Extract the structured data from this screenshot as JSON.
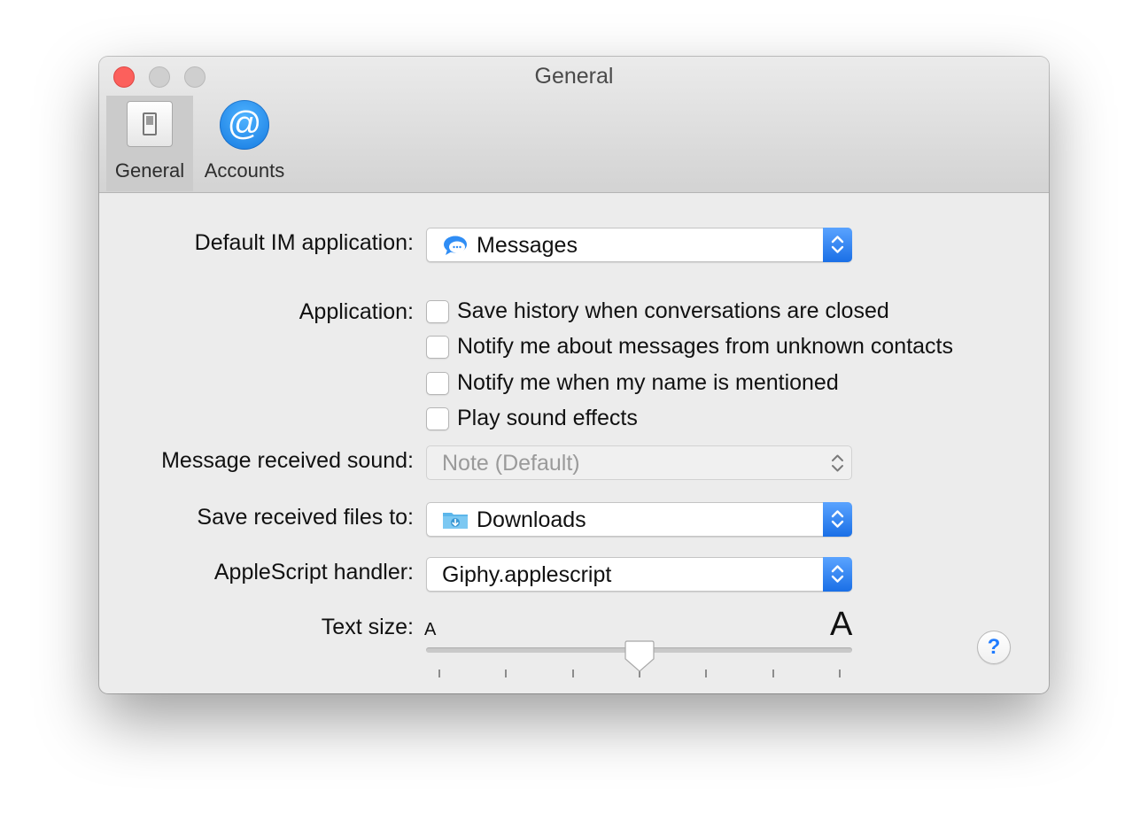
{
  "window": {
    "title": "General"
  },
  "toolbar": {
    "items": [
      {
        "label": "General",
        "icon": "switch-icon",
        "selected": true
      },
      {
        "label": "Accounts",
        "icon": "at-sign-icon",
        "glyph": "@",
        "selected": false
      }
    ]
  },
  "prefs": {
    "default_im": {
      "label": "Default IM application:",
      "value": "Messages",
      "icon": "messages-icon"
    },
    "application": {
      "label": "Application:",
      "options": [
        {
          "label": "Save history when conversations are closed",
          "checked": false
        },
        {
          "label": "Notify me about messages from unknown contacts",
          "checked": false
        },
        {
          "label": "Notify me when my name is mentioned",
          "checked": false
        },
        {
          "label": "Play sound effects",
          "checked": false
        }
      ]
    },
    "sound": {
      "label": "Message received sound:",
      "value": "Note (Default)",
      "enabled": false
    },
    "save_files": {
      "label": "Save received files to:",
      "value": "Downloads",
      "icon": "downloads-folder-icon"
    },
    "applescript": {
      "label": "AppleScript handler:",
      "value": "Giphy.applescript"
    },
    "text_size": {
      "label": "Text size:",
      "small_glyph": "A",
      "large_glyph": "A",
      "ticks": 7,
      "selected_step": 4
    }
  },
  "help": {
    "glyph": "?"
  },
  "colors": {
    "accent": "#1a6fe6",
    "close": "#fc605c",
    "window_bg": "#ececec"
  }
}
